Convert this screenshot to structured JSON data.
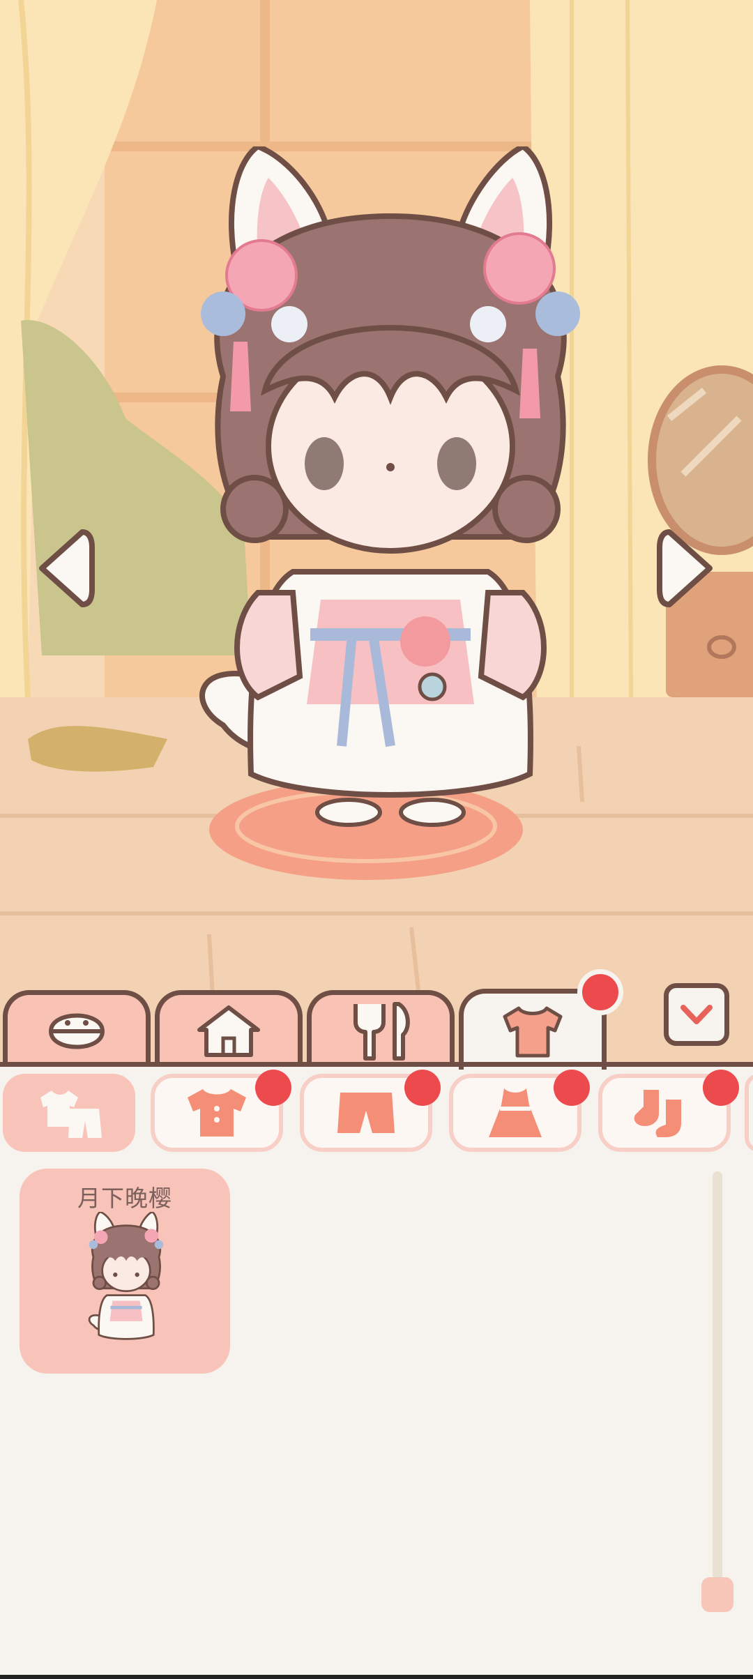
{
  "main_tabs": [
    {
      "name": "face",
      "icon": "face-icon",
      "active": false
    },
    {
      "name": "home",
      "icon": "house-icon",
      "active": false
    },
    {
      "name": "food",
      "icon": "fork-knife-icon",
      "active": false
    },
    {
      "name": "clothing",
      "icon": "shirt-icon",
      "active": true
    }
  ],
  "sub_tabs": [
    {
      "icon": "outfit-set-icon",
      "active": true
    },
    {
      "icon": "top-icon",
      "active": false
    },
    {
      "icon": "pants-icon",
      "active": false
    },
    {
      "icon": "dress-icon",
      "active": false
    },
    {
      "icon": "socks-icon",
      "active": false
    }
  ],
  "items": [
    {
      "name": "月下晚樱",
      "icon": "outfit-thumbnail"
    }
  ],
  "colors": {
    "outline": "#6e4e45",
    "tab_inactive": "#f8c3b4",
    "panel_bg": "#f6f3ee",
    "badge": "#ec4a4c",
    "card": "#f8c3b8"
  }
}
